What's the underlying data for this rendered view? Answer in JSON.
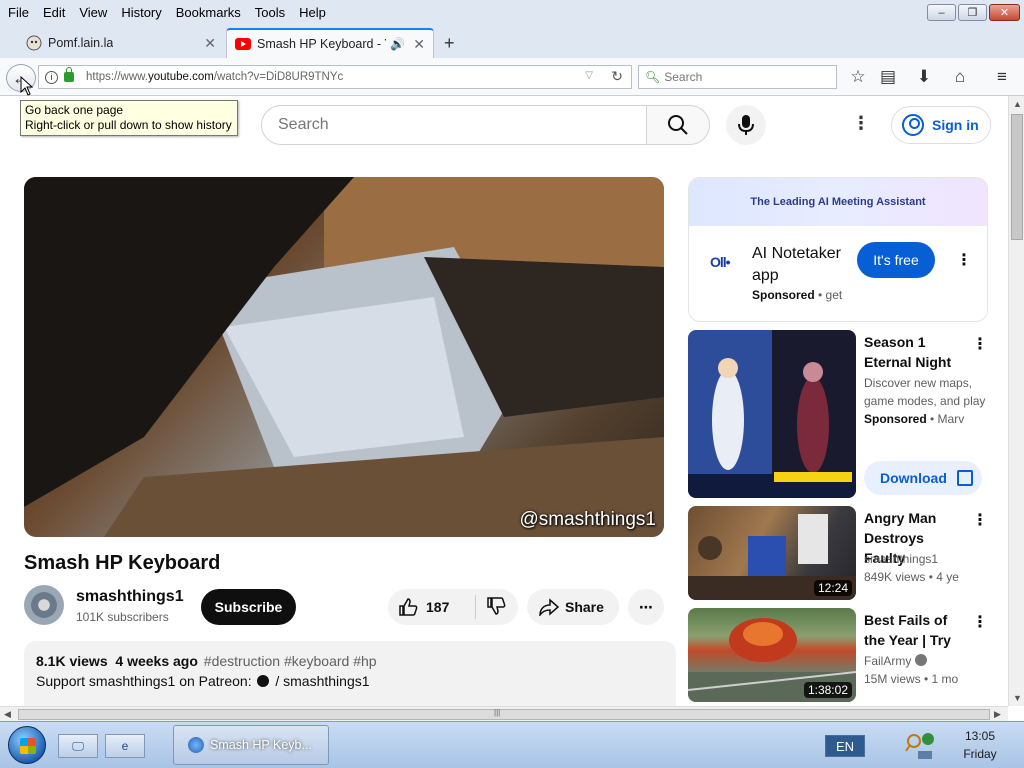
{
  "menubar": {
    "items": [
      "File",
      "Edit",
      "View",
      "History",
      "Bookmarks",
      "Tools",
      "Help"
    ]
  },
  "tabs": [
    {
      "title": "Pomf.lain.la",
      "active": false
    },
    {
      "title": "Smash HP Keyboard - Y",
      "active": true,
      "audio": true
    }
  ],
  "navbar": {
    "url_prefix": "https://www.",
    "url_host": "youtube.com",
    "url_path": "/watch?v=DiD8UR9TNYc",
    "search_placeholder": "Search"
  },
  "tooltip": {
    "line1": "Go back one page",
    "line2": "Right-click or pull down to show history"
  },
  "youtube": {
    "search_placeholder": "Search",
    "signin_label": "Sign in",
    "video": {
      "watermark": "@smashthings1",
      "title": "Smash HP Keyboard",
      "channel": "smashthings1",
      "subscribers": "101K subscribers",
      "subscribe_label": "Subscribe",
      "likes": "187",
      "share_label": "Share",
      "views": "8.1K views",
      "age": "4 weeks ago",
      "tags": "#destruction #keyboard #hp",
      "desc_prefix": "Support smashthings1 on Patreon:",
      "desc_link": "/ smashthings1"
    },
    "ad": {
      "banner": "The Leading AI Meeting Assistant",
      "logo": "Oll•",
      "title": "AI Notetaker app",
      "sponsored": "Sponsored",
      "sponsored_suffix": "• get",
      "cta": "It's free"
    },
    "sidebar": [
      {
        "title": "Season 1 Eternal Night",
        "meta": "Discover new maps, game modes, and play",
        "sponsored": "Sponsored",
        "sponsored_suffix": "• Marv",
        "download": "Download"
      },
      {
        "title": "Angry Man Destroys Faulty",
        "channel": "smashthings1",
        "stats": "849K views  • 4 ye",
        "duration": "12:24"
      },
      {
        "title": "Best Fails of the Year | Try",
        "channel": "FailArmy",
        "stats": "15M views  • 1 mo",
        "duration": "1:38:02"
      }
    ]
  },
  "taskbar": {
    "window_title": "Smash HP Keyb...",
    "language": "EN",
    "time": "13:05",
    "day": "Friday"
  },
  "colors": {
    "youtube_red": "#ff0000",
    "link_blue": "#065fd4",
    "chrome_bg": "#dfe7f3",
    "taskbar_bg": "#a9c4e6"
  }
}
